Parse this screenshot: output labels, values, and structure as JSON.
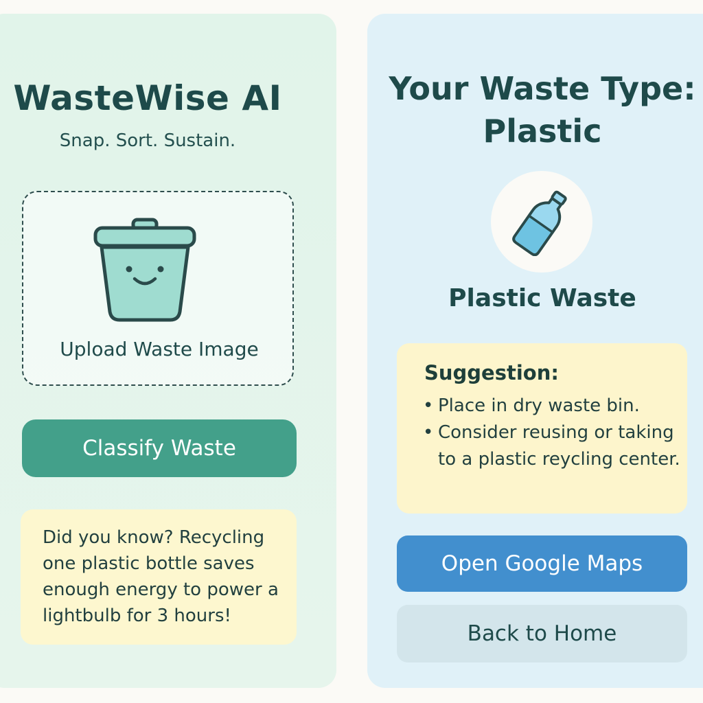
{
  "app": {
    "title": "WasteWise AI",
    "tagline": "Snap. Sort. Sustain."
  },
  "upload": {
    "icon": "trash-bin-smiley-icon",
    "label": "Upload Waste Image"
  },
  "classify_button": {
    "label": "Classify Waste"
  },
  "fact": {
    "text": "Did you know? Recycling one plastic bottle saves enough energy to power a lightbulb for 3 hours!"
  },
  "result": {
    "heading_line1": "Your Waste Type:",
    "heading_line2": "Plastic",
    "icon": "plastic-bottle-icon",
    "waste_label": "Plastic Waste"
  },
  "suggestion": {
    "title": "Suggestion:",
    "items": [
      "Place in dry waste bin.",
      "Consider reusing or taking to a plastic reycling center."
    ]
  },
  "buttons": {
    "maps_label": "Open Google Maps",
    "home_label": "Back to Home"
  },
  "colors": {
    "primary_green": "#43a08a",
    "maps_blue": "#428fce",
    "card_yellow": "#fdf7cf"
  }
}
